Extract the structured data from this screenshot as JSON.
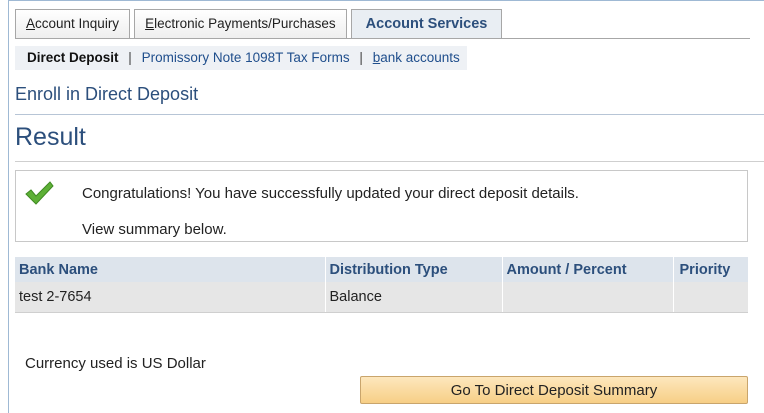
{
  "tabs": [
    {
      "label": "Account Inquiry",
      "active": false
    },
    {
      "label": "Electronic Payments/Purchases",
      "active": false
    },
    {
      "label": "Account Services",
      "active": true
    }
  ],
  "subnav": {
    "current": "Direct Deposit",
    "links": [
      "Promissory Note 1098T Tax Forms",
      "bank accounts"
    ],
    "separator": "|"
  },
  "page": {
    "subtitle": "Enroll in Direct Deposit",
    "result_heading": "Result"
  },
  "message": {
    "icon": "checkmark-icon",
    "line1": "Congratulations! You have successfully updated your direct deposit details.",
    "line2": "View summary below."
  },
  "table": {
    "headers": [
      "Bank Name",
      "Distribution Type",
      "Amount / Percent",
      "Priority"
    ],
    "rows": [
      [
        "test 2-7654",
        "Balance",
        "",
        ""
      ]
    ]
  },
  "footer": {
    "currency_note": "Currency used is US Dollar",
    "summary_button": "Go To Direct Deposit Summary"
  },
  "colors": {
    "heading": "#2c4f7c",
    "link": "#1f4e8c",
    "check": "#5db036",
    "button": "#f7cf86"
  }
}
